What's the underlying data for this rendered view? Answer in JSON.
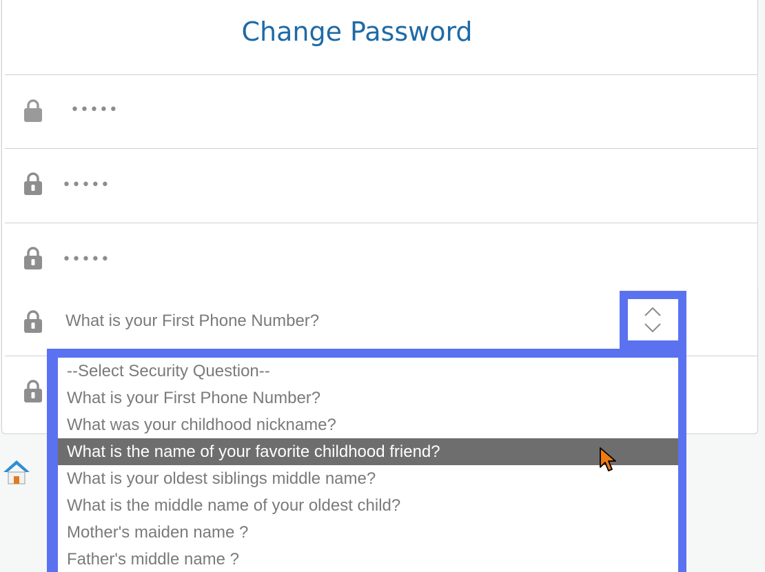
{
  "page": {
    "title": "Change Password"
  },
  "fields": {
    "current_password": "•••••",
    "new_password": "•••••",
    "confirm_password": "•••••"
  },
  "security_question": {
    "selected": "What is your First Phone Number?",
    "highlighted_index": 3,
    "options": [
      "--Select Security Question--",
      "What is your First Phone Number?",
      "What was your childhood nickname?",
      "What is the name of your favorite childhood friend?",
      "What is your oldest siblings middle name?",
      "What is the middle name of your oldest child?",
      "Mother's maiden name ?",
      "Father's middle name ?"
    ]
  },
  "icons": {
    "lock": "lock-icon",
    "spinner": "up-down-chevron-icon",
    "cursor": "mouse-pointer-icon",
    "home": "home-icon"
  },
  "colors": {
    "title": "#1e6aa6",
    "highlight_frame": "#5a72f0",
    "option_highlight": "#6e6e6e",
    "cursor": "#f07a12"
  }
}
